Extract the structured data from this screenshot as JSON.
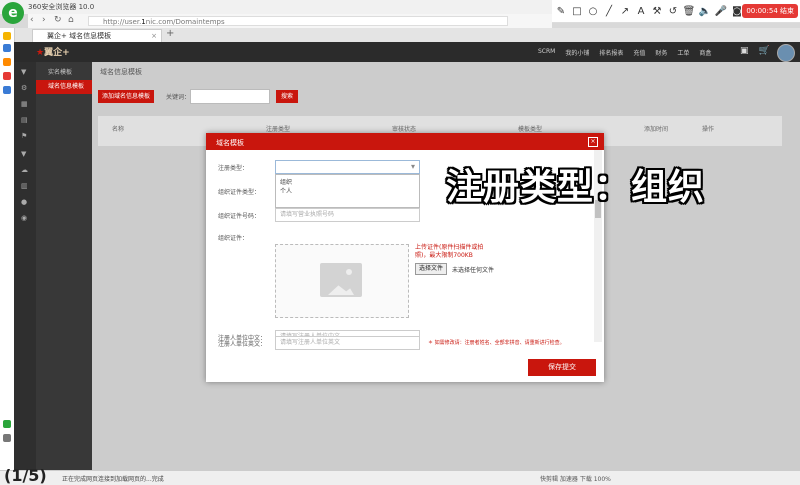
{
  "browser": {
    "title": "360安全浏览器 10.0",
    "url_prefix": "http://user.",
    "url_domain": "1",
    "url_suffix": "nic.com/Domaintemps",
    "tab_label": "翼企+ 域名信息模板",
    "tab_close": "×",
    "tab_plus": "+",
    "recording": "00:00:54 结束"
  },
  "app": {
    "brand": "翼企+",
    "nav": [
      "SCRM",
      "我的小铺",
      "排名报表",
      "充值",
      "财务",
      "工单",
      "商盒"
    ],
    "sidebar_header": "实名模板",
    "sidebar_active": "域名信息模板",
    "breadcrumb": "域名信息模板"
  },
  "toolbar": {
    "add_label": "添加域名信息模板",
    "keyword_label": "关键词：",
    "search_label": "搜索"
  },
  "table": {
    "headers": [
      "名称",
      "注册类型",
      "审核状态",
      "模板类型",
      "添加时间",
      "操作"
    ]
  },
  "modal": {
    "title": "域名模板",
    "close": "×",
    "reg_type_label": "注册类型：",
    "reg_type_options": [
      "组织",
      "个人"
    ],
    "id_type_label": "组织证件类型：",
    "id_number_label": "组织证件号码：",
    "id_number_placeholder": "请填写营业执照号码",
    "id_doc_label": "组织证件：",
    "upload_hint": "上传证件(原件扫描件或拍照)，最大限制700KB",
    "file_button": "选择文件",
    "file_none": "未选择任何文件",
    "cn_name_label": "注册人单位中文：",
    "cn_name_placeholder": "请填写注册人单位中文",
    "en_name_label": "注册人单位英文：",
    "en_name_placeholder": "请填写注册人单位英文",
    "note": "＊ 如需修改请：注册者姓名、全部非拼音、请重新进行检查。",
    "save_label": "保存提交"
  },
  "caption": "注册类型：组织",
  "statusbar": {
    "text": "正在完成网页连接到加载网页的...完成",
    "right": "快剪辑  加速器  下载  100%",
    "counter": "(1/5)"
  },
  "colors": {
    "accent": "#c9160d",
    "dark_nav": "#2b2b2b"
  }
}
